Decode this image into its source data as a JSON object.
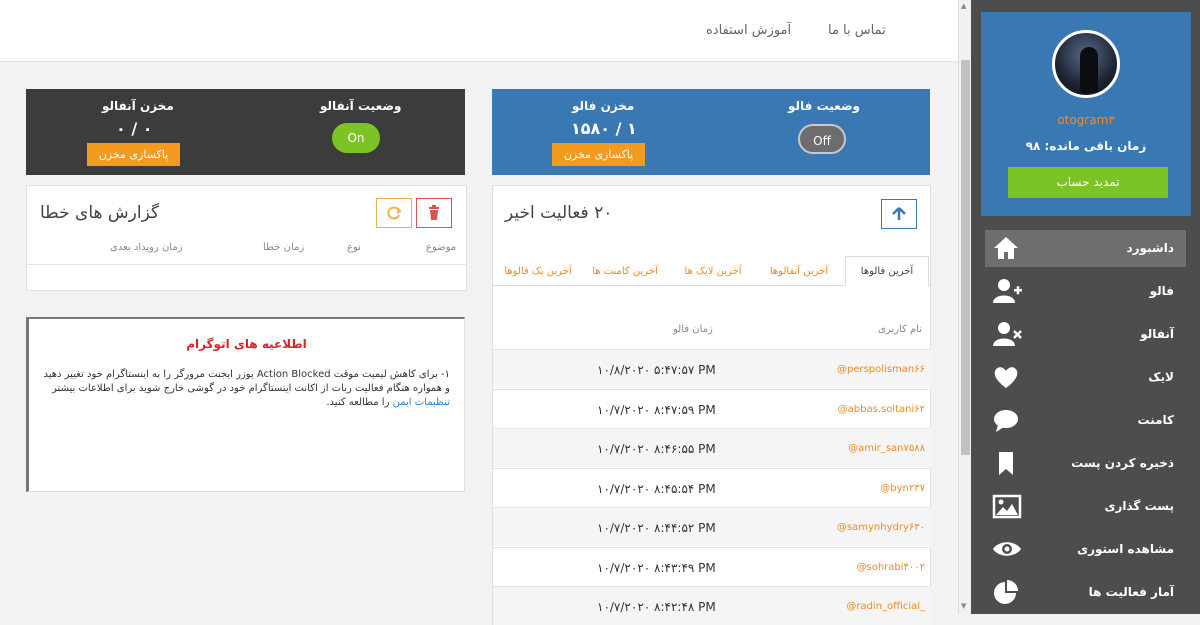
{
  "topnav": {
    "contact": "تماس با ما",
    "tutorial": "آموزش استفاده"
  },
  "profile": {
    "username": "otogram۳",
    "remaining": "زمان باقی مانده: ۹۸",
    "renew": "تمدید حساب"
  },
  "sidebar": {
    "items": [
      {
        "label": "داشبورد",
        "icon": "home-icon"
      },
      {
        "label": "فالو",
        "icon": "user-plus-icon"
      },
      {
        "label": "آنفالو",
        "icon": "user-remove-icon"
      },
      {
        "label": "لایک",
        "icon": "heart-icon"
      },
      {
        "label": "کامنت",
        "icon": "comment-icon"
      },
      {
        "label": "ذخیره کردن پست",
        "icon": "bookmark-icon"
      },
      {
        "label": "پست گذاری",
        "icon": "image-icon"
      },
      {
        "label": "مشاهده استوری",
        "icon": "eye-icon"
      },
      {
        "label": "آمار فعالیت ها",
        "icon": "pie-chart-icon"
      }
    ]
  },
  "follow_box": {
    "status_title": "وضعیت فالو",
    "toggle": "Off",
    "store_title": "مخزن فالو",
    "store_value": "۱۵۸۰ / ۱",
    "clear": "پاکسازی مخزن",
    "color": "#3a78b4"
  },
  "unfollow_box": {
    "status_title": "وضعیت آنفالو",
    "toggle": "On",
    "store_title": "مخزن آنفالو",
    "store_value": "۰ / ۰",
    "clear": "پاکسازی مخزن",
    "color": "#3c3c3c"
  },
  "activity": {
    "title": "۲۰ فعالیت اخیر",
    "tabs": [
      "آخرین فالوها",
      "آخرین آنفالوها",
      "آخرین لایک ها",
      "آخرین کامنت ها",
      "آخرین بک فالوها"
    ],
    "col_user": "نام کاربری",
    "col_time": "زمان فالو",
    "rows": [
      {
        "user": "@perspolisman۶۶",
        "time": "۱۰/۸/۲۰۲۰ ۵:۴۷:۵۷ PM"
      },
      {
        "user": "@abbas.soltani۶۲",
        "time": "۱۰/۷/۲۰۲۰ ۸:۴۷:۵۹ PM"
      },
      {
        "user": "@amir_san۷۵۸۸",
        "time": "۱۰/۷/۲۰۲۰ ۸:۴۶:۵۵ PM"
      },
      {
        "user": "@byn۲۳۷",
        "time": "۱۰/۷/۲۰۲۰ ۸:۴۵:۵۴ PM"
      },
      {
        "user": "@samynhydry۶۳۰",
        "time": "۱۰/۷/۲۰۲۰ ۸:۴۴:۵۲ PM"
      },
      {
        "user": "@sohrabi۴۰۰۲",
        "time": "۱۰/۷/۲۰۲۰ ۸:۴۳:۴۹ PM"
      },
      {
        "user": "@radin_official_",
        "time": "۱۰/۷/۲۰۲۰ ۸:۴۲:۴۸ PM"
      }
    ]
  },
  "errors": {
    "title": "گزارش های خطا",
    "cols": [
      "موضوع",
      "نوع",
      "زمان خطا",
      "زمان رویداد بعدی"
    ]
  },
  "notice": {
    "title": "اطلاعیه های اتوگرام",
    "body_pre": "۱-  برای کاهش لیمیت موقت Action Blocked یوزر ایجنت مرورگر را به اینستاگرام خود تغییر دهید و همواره هنگام فعالیت ربات از اکانت اینستاگرام خود در گوشی خارج شوید برای اطلاعات بیشتر ",
    "body_link": "تنظیمات ایمن",
    "body_post": " را مطالعه کنید."
  }
}
